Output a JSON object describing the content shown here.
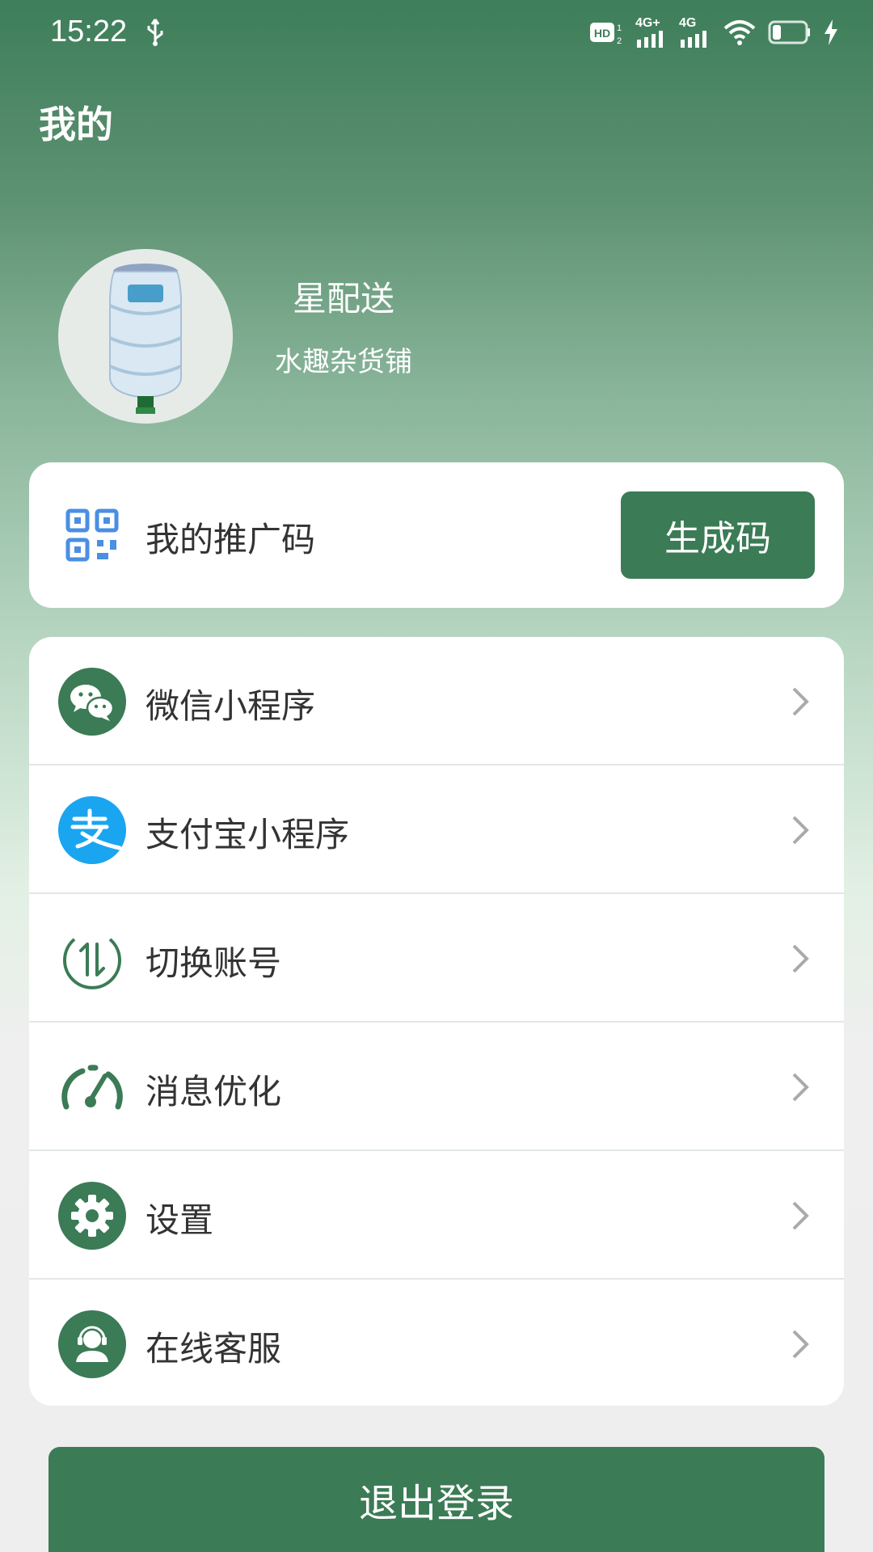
{
  "status_bar": {
    "time": "15:22",
    "net1": "4G+",
    "net2": "4G",
    "hd_label": "HD"
  },
  "header": {
    "title": "我的"
  },
  "profile": {
    "name": "星配送",
    "shop": "水趣杂货铺",
    "avatar": "water-bottle-image"
  },
  "promo": {
    "label": "我的推广码",
    "button": "生成码",
    "icon": "qr-code-icon"
  },
  "menu": {
    "items": [
      {
        "label": "微信小程序",
        "icon": "wechat-icon"
      },
      {
        "label": "支付宝小程序",
        "icon": "alipay-icon"
      },
      {
        "label": "切换账号",
        "icon": "switch-account-icon"
      },
      {
        "label": "消息优化",
        "icon": "gauge-icon"
      },
      {
        "label": "设置",
        "icon": "gear-icon"
      },
      {
        "label": "在线客服",
        "icon": "customer-service-icon"
      }
    ]
  },
  "logout": {
    "label": "退出登录"
  },
  "colors": {
    "brand_green": "#3b7b56",
    "alipay_blue": "#1aa5f0",
    "qr_blue": "#4a8fe3",
    "text_dark": "#333333"
  }
}
